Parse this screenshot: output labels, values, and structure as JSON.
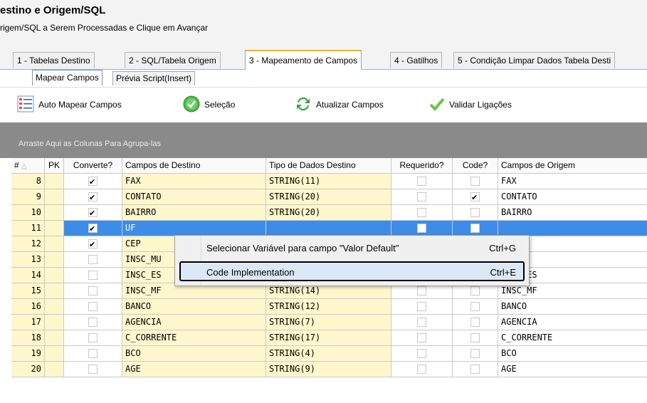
{
  "header": {
    "title": "estino e Origem/SQL",
    "subtitle": "rigem/SQL a Serem Processadas e Clique em Avançar"
  },
  "tabs": [
    {
      "label": "1 - Tabelas Destino"
    },
    {
      "label": "2 - SQL/Tabela Origem"
    },
    {
      "label": "3 - Mapeamento de Campos"
    },
    {
      "label": "4 - Gatilhos"
    },
    {
      "label": "5 - Condição Limpar Dados Tabela Desti"
    }
  ],
  "subtabs": [
    {
      "label": "Mapear Campos"
    },
    {
      "label": "Prévia Script(Insert)"
    }
  ],
  "toolbar": {
    "auto_map": "Auto Mapear Campos",
    "selection": "Seleção",
    "refresh": "Atualizar Campos",
    "validate": "Validar Ligações"
  },
  "group_bar": "Arraste Aqui as Colunas Para Agrupa-las",
  "grid": {
    "columns": [
      "#",
      "PK",
      "Converte?",
      "Campos de Destino",
      "Tipo de Dados Destino",
      "Requerido?",
      "Code?",
      "Campos de Origem"
    ],
    "rows": [
      {
        "n": "8",
        "convert": true,
        "dest": "FAX",
        "type": "STRING(11)",
        "req": false,
        "code": false,
        "orig": "FAX"
      },
      {
        "n": "9",
        "convert": true,
        "dest": "CONTATO",
        "type": "STRING(20)",
        "req": false,
        "code": true,
        "orig": "CONTATO"
      },
      {
        "n": "10",
        "convert": true,
        "dest": "BAIRRO",
        "type": "STRING(20)",
        "req": false,
        "code": false,
        "orig": "BAIRRO"
      },
      {
        "n": "11",
        "convert": true,
        "dest": "UF",
        "type": "",
        "req": false,
        "code": false,
        "orig": "",
        "selected": true
      },
      {
        "n": "12",
        "convert": true,
        "dest": "CEP",
        "type": "",
        "req": false,
        "code": false,
        "orig": ""
      },
      {
        "n": "13",
        "convert": false,
        "dest": "INSC_MU",
        "type": "",
        "req": false,
        "code": false,
        "orig": "MU"
      },
      {
        "n": "14",
        "convert": false,
        "dest": "INSC_ES",
        "type": "STRING(14)",
        "req": false,
        "code": false,
        "orig": "INSC_ES"
      },
      {
        "n": "15",
        "convert": false,
        "dest": "INSC_MF",
        "type": "STRING(14)",
        "req": false,
        "code": false,
        "orig": "INSC_MF"
      },
      {
        "n": "16",
        "convert": false,
        "dest": "BANCO",
        "type": "STRING(12)",
        "req": false,
        "code": false,
        "orig": "BANCO"
      },
      {
        "n": "17",
        "convert": false,
        "dest": "AGENCIA",
        "type": "STRING(7)",
        "req": false,
        "code": false,
        "orig": "AGENCIA"
      },
      {
        "n": "18",
        "convert": false,
        "dest": "C_CORRENTE",
        "type": "STRING(17)",
        "req": false,
        "code": false,
        "orig": "C_CORRENTE"
      },
      {
        "n": "19",
        "convert": false,
        "dest": "BCO",
        "type": "STRING(4)",
        "req": false,
        "code": false,
        "orig": "BCO"
      },
      {
        "n": "20",
        "convert": false,
        "dest": "AGE",
        "type": "STRING(9)",
        "req": false,
        "code": false,
        "orig": "AGE"
      }
    ]
  },
  "context_menu": {
    "items": [
      {
        "label": "Selecionar Variável para campo \"Valor Default\"",
        "shortcut": "Ctrl+G"
      },
      {
        "label": "Code Implementation",
        "shortcut": "Ctrl+E"
      }
    ]
  }
}
